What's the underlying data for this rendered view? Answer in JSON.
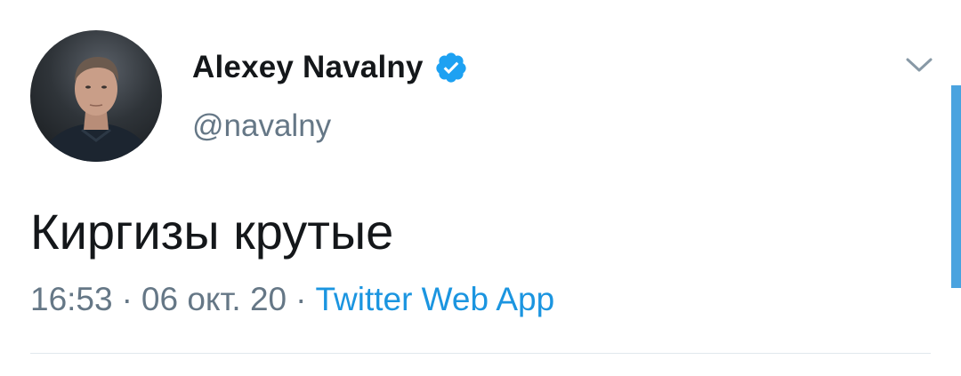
{
  "tweet": {
    "author": {
      "display_name": "Alexey Navalny",
      "handle": "@navalny",
      "verified": true,
      "avatar_icon": "profile-photo"
    },
    "text": "Киргизы крутые",
    "meta": {
      "time": "16:53",
      "separator": "·",
      "date": "06 окт. 20",
      "source": "Twitter Web App"
    },
    "menu_icon": "chevron-down-icon"
  },
  "colors": {
    "primary_text": "#14171a",
    "secondary_text": "#657786",
    "link": "#1b95e0",
    "verified_badge": "#1da1f2",
    "divider": "#e1e8ed",
    "scrollbar": "#4aa3df"
  }
}
